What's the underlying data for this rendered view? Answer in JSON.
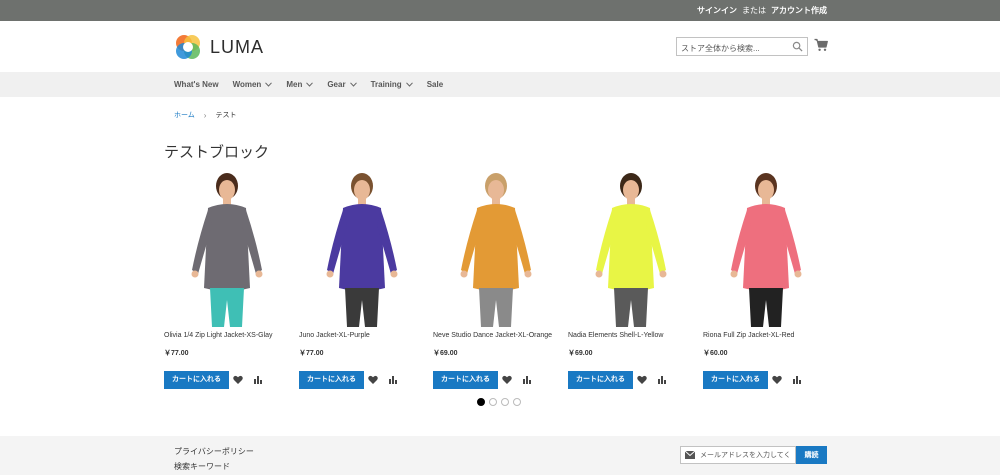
{
  "header_links": {
    "sign_in": "サインイン",
    "or": "または",
    "create_account": "アカウント作成"
  },
  "logo": {
    "text": "LUMA"
  },
  "search": {
    "placeholder": "ストア全体から検索..."
  },
  "nav": {
    "items": [
      {
        "label": "What's New",
        "dropdown": false
      },
      {
        "label": "Women",
        "dropdown": true
      },
      {
        "label": "Men",
        "dropdown": true
      },
      {
        "label": "Gear",
        "dropdown": true
      },
      {
        "label": "Training",
        "dropdown": true
      },
      {
        "label": "Sale",
        "dropdown": false
      }
    ]
  },
  "breadcrumb": {
    "home": "ホーム",
    "separator": "›",
    "current": "テスト"
  },
  "block": {
    "title": "テストブロック"
  },
  "products": [
    {
      "name": "Olivia 1/4 Zip Light Jacket-XS-Glay",
      "price": "￥77.00",
      "add_to_cart": "カートに入れる",
      "jacket_color": "#6e6b72",
      "pants_color": "#3fbfb5"
    },
    {
      "name": "Juno Jacket-XL-Purple",
      "price": "￥77.00",
      "add_to_cart": "カートに入れる",
      "jacket_color": "#4b3aa0",
      "pants_color": "#3a3a3a"
    },
    {
      "name": "Neve Studio Dance Jacket-XL-Orange",
      "price": "￥69.00",
      "add_to_cart": "カートに入れる",
      "jacket_color": "#e39a35",
      "pants_color": "#8a8a8a"
    },
    {
      "name": "Nadia Elements Shell-L-Yellow",
      "price": "￥69.00",
      "add_to_cart": "カートに入れる",
      "jacket_color": "#e8f545",
      "pants_color": "#5a5a5a"
    },
    {
      "name": "Riona Full Zip Jacket-XL-Red",
      "price": "￥60.00",
      "add_to_cart": "カートに入れる",
      "jacket_color": "#ee6f7e",
      "pants_color": "#222222"
    }
  ],
  "pager": {
    "pages": 4,
    "active": 1
  },
  "footer": {
    "links": [
      "プライバシーポリシー",
      "検索キーワード"
    ],
    "newsletter_placeholder": "メールアドレスを入力してく",
    "subscribe": "購読"
  },
  "colors": {
    "accent": "#1979c3",
    "topbar": "#6e716e",
    "nav_bg": "#f0f0f0"
  },
  "icons": [
    "search-icon",
    "cart-icon",
    "chevron-down-icon",
    "heart-icon",
    "compare-icon",
    "mail-icon"
  ]
}
